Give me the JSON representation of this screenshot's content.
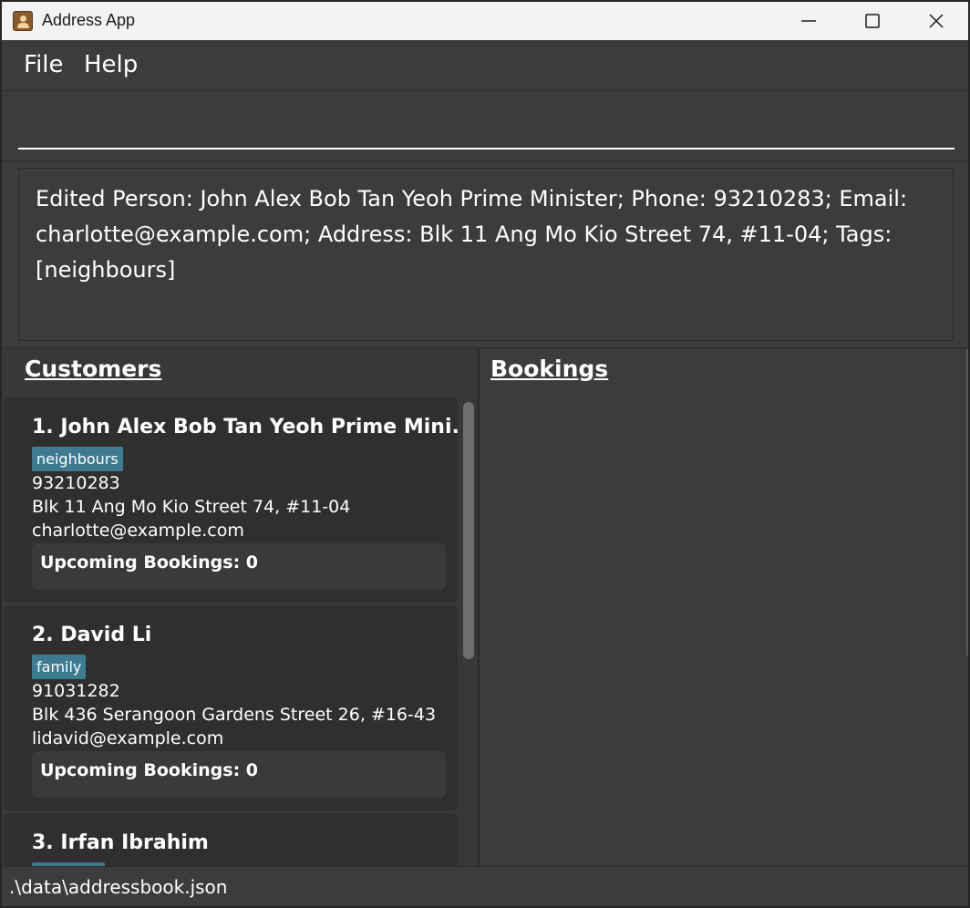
{
  "window": {
    "title": "Address App"
  },
  "menu": {
    "file": "File",
    "help": "Help"
  },
  "command": {
    "value": "",
    "placeholder": ""
  },
  "result": {
    "message": "Edited Person: John Alex Bob Tan Yeoh Prime Minister; Phone: 93210283; Email: charlotte@example.com; Address: Blk 11 Ang Mo Kio Street 74, #11-04; Tags: [neighbours]"
  },
  "customers": {
    "header": "Customers",
    "items": [
      {
        "name": "1. John Alex Bob Tan Yeoh Prime Mini...",
        "tag": "neighbours",
        "phone": "93210283",
        "address": "Blk 11 Ang Mo Kio Street 74, #11-04",
        "email": "charlotte@example.com",
        "bookings_label": "Upcoming Bookings:  0"
      },
      {
        "name": "2. David Li",
        "tag": "family",
        "phone": "91031282",
        "address": "Blk 436 Serangoon Gardens Street 26, #16-43",
        "email": "lidavid@example.com",
        "bookings_label": "Upcoming Bookings:  0"
      },
      {
        "name": "3. Irfan Ibrahim"
      }
    ]
  },
  "bookings": {
    "header": "Bookings"
  },
  "status": {
    "file_path": ".\\data\\addressbook.json"
  },
  "colors": {
    "background": "#3c3c3c",
    "card": "#2f2f2f",
    "tag": "#3e7b91",
    "titlebar": "#f3f3f3"
  }
}
